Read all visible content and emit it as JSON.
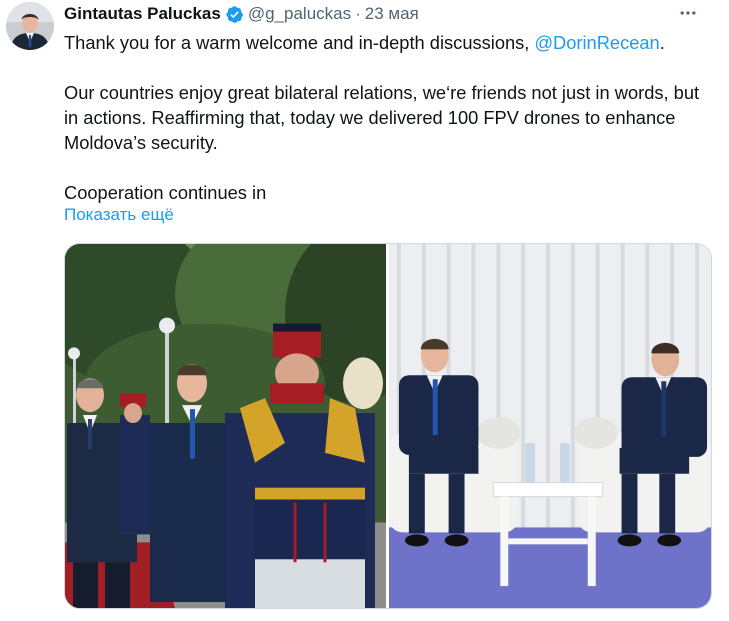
{
  "author": {
    "name": "Gintautas Paluckas",
    "handle": "@g_paluckas",
    "separator": "·",
    "date": "23 мая",
    "verified": true
  },
  "tweet": {
    "line1_text": "Thank you for a warm welcome and in-depth discussions, ",
    "line1_mention": "@DorinRecean",
    "line1_end": ".",
    "paragraph2": "Our countries enjoy great bilateral relations, we‘re friends not just in words, but in actions. Reaffirming that, today we delivered 100 FPV drones to enhance Moldova’s security.",
    "paragraph3": "Cooperation continues in",
    "show_more": "Показать ещё"
  },
  "media": {
    "photos": [
      {
        "alt": "photo-honor-guard"
      },
      {
        "alt": "photo-meeting-armchairs"
      }
    ]
  },
  "icons": {
    "verified": "verified-badge-icon",
    "more": "more-horizontal-icon"
  },
  "colors": {
    "accent": "#1d9bf0",
    "text": "#0f1419",
    "muted": "#536471"
  }
}
